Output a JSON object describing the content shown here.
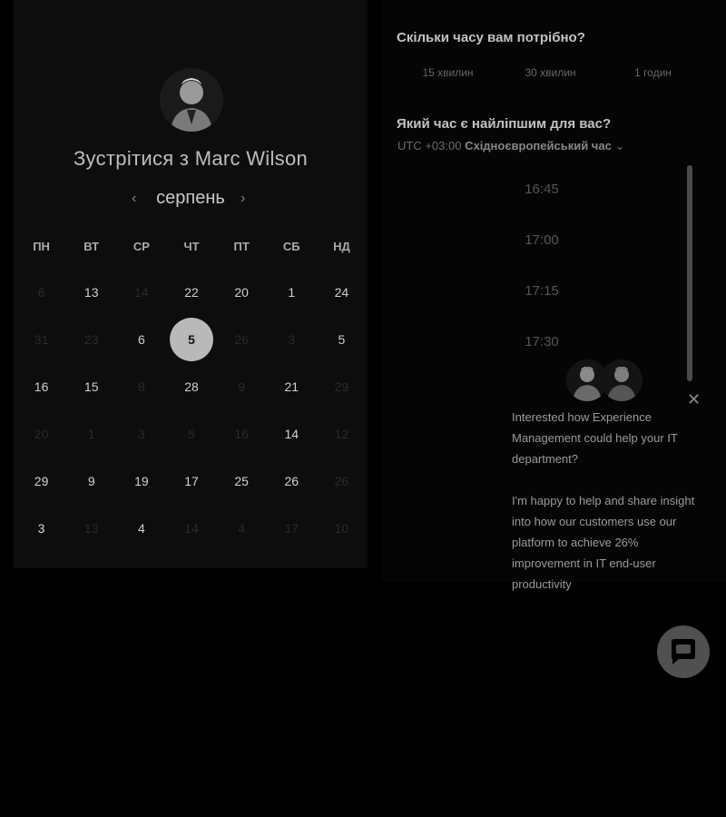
{
  "booking": {
    "title": "Зустрітися з Marc Wilson",
    "month": "серпень",
    "weekdays": [
      "ПН",
      "ВТ",
      "СР",
      "ЧТ",
      "ПТ",
      "СБ",
      "НД"
    ],
    "weeks": [
      [
        {
          "d": "6",
          "m": true
        },
        {
          "d": "13",
          "m": false
        },
        {
          "d": "14",
          "m": true
        },
        {
          "d": "22",
          "m": false
        },
        {
          "d": "20",
          "m": false
        },
        {
          "d": "1",
          "m": false
        },
        {
          "d": "24",
          "m": false
        }
      ],
      [
        {
          "d": "31",
          "m": true
        },
        {
          "d": "23",
          "m": true
        },
        {
          "d": "6",
          "m": false
        },
        {
          "d": "5",
          "m": false,
          "selected": true
        },
        {
          "d": "26",
          "m": true
        },
        {
          "d": "3",
          "m": true
        },
        {
          "d": "5",
          "m": false
        }
      ],
      [
        {
          "d": "16",
          "m": false
        },
        {
          "d": "15",
          "m": false
        },
        {
          "d": "8",
          "m": true
        },
        {
          "d": "28",
          "m": false
        },
        {
          "d": "9",
          "m": true
        },
        {
          "d": "21",
          "m": false
        },
        {
          "d": "29",
          "m": true
        }
      ],
      [
        {
          "d": "20",
          "m": true
        },
        {
          "d": "1",
          "m": true
        },
        {
          "d": "3",
          "m": true
        },
        {
          "d": "5",
          "m": true
        },
        {
          "d": "16",
          "m": true
        },
        {
          "d": "14",
          "m": false
        },
        {
          "d": "12",
          "m": true
        }
      ],
      [
        {
          "d": "29",
          "m": false
        },
        {
          "d": "9",
          "m": false
        },
        {
          "d": "19",
          "m": false
        },
        {
          "d": "17",
          "m": false
        },
        {
          "d": "25",
          "m": false
        },
        {
          "d": "26",
          "m": false
        },
        {
          "d": "26",
          "m": true
        }
      ],
      [
        {
          "d": "3",
          "m": false
        },
        {
          "d": "13",
          "m": true
        },
        {
          "d": "4",
          "m": false
        },
        {
          "d": "14",
          "m": true
        },
        {
          "d": "4",
          "m": true
        },
        {
          "d": "17",
          "m": true
        },
        {
          "d": "10",
          "m": true
        }
      ]
    ]
  },
  "duration": {
    "question": "Скільки часу вам потрібно?",
    "options": [
      "15 хвилин",
      "30 хвилин",
      "1 годин"
    ]
  },
  "time": {
    "question": "Який час є найліпшим для вас?",
    "tz_offset": "UTC +03:00",
    "tz_name": "Східноєвропейський час",
    "tz_arrow": "⌄",
    "slots": [
      "16:45",
      "17:00",
      "17:15",
      "17:30"
    ]
  },
  "chat": {
    "close": "✕",
    "message1": "Interested how Experience Management could help your IT department?",
    "message2": "I'm happy to help and share insight into how our customers use our platform to achieve 26% improvement in IT end-user productivity"
  },
  "icons": {
    "prev": "‹",
    "next": "›",
    "chat": "chat-bubble-icon",
    "avatar": "person-avatar-icon"
  }
}
